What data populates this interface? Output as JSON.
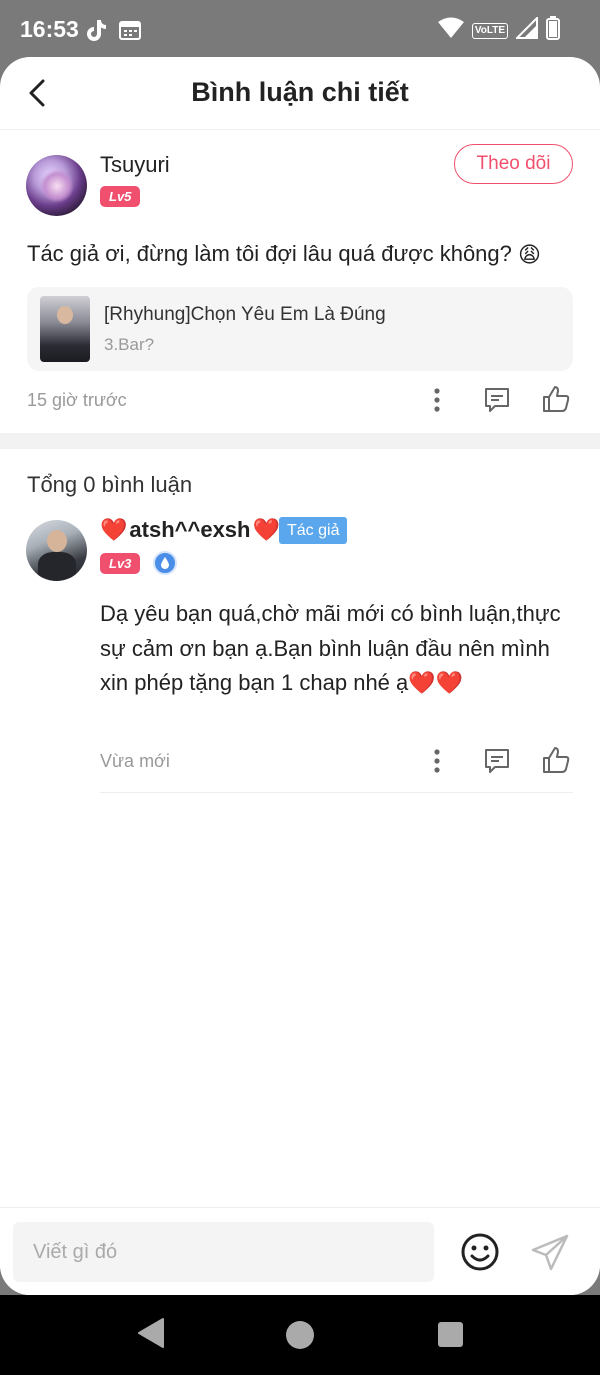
{
  "status_bar": {
    "time": "16:53",
    "network_label": "VoLTE",
    "icons": [
      "tiktok-icon",
      "calendar-icon",
      "wifi-icon",
      "signal-icon",
      "battery-icon"
    ]
  },
  "header": {
    "title": "Bình luận chi tiết"
  },
  "main_comment": {
    "username": "Tsuyuri",
    "level": "Lv5",
    "follow_label": "Theo dõi",
    "text": "Tác giả ơi, đừng làm tôi đợi lâu quá được không?",
    "emoji": "😩",
    "story": {
      "title": "[Rhyhung]Chọn Yêu Em Là Đúng",
      "chapter": "3.Bar?"
    },
    "time": "15 giờ trước"
  },
  "comments_section": {
    "total_label": "Tổng 0 bình luận"
  },
  "reply": {
    "username_prefix": "❤️",
    "username": "atsh^^exsh",
    "username_suffix": "❤️",
    "author_tag": "Tác giả",
    "level": "Lv3",
    "text": "Dạ yêu bạn quá,chờ mãi mới có bình luận,thực sự cảm ơn bạn ạ.Bạn bình luận đầu nên mình xin phép tặng bạn 1 chap nhé ạ❤️❤️",
    "time": "Vừa mới"
  },
  "input_bar": {
    "placeholder": "Viết gì đó"
  },
  "colors": {
    "accent": "#f0506e",
    "author_tag": "#5aa7ee",
    "status_bar": "#7a7a7a"
  }
}
